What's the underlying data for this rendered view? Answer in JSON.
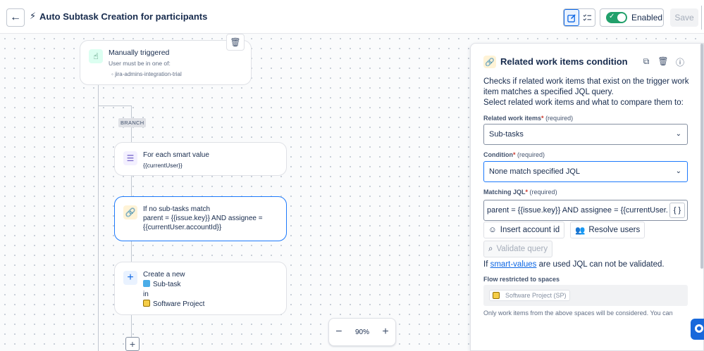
{
  "header": {
    "back_icon": "arrow-left-icon",
    "rule_icon": "lightning-icon",
    "title": "Auto Subtask Creation for participants",
    "enabled_label": "Enabled",
    "save_label": "Save"
  },
  "canvas": {
    "trigger": {
      "title": "Manually triggered",
      "subtitle": "User must be in one of:",
      "group": "jira-admins-integration-trial"
    },
    "branch_label": "BRANCH",
    "foreach": {
      "title": "For each smart value",
      "value": "{{currentUser}}"
    },
    "condition": {
      "title": "If no sub-tasks match",
      "line1": "parent = {{issue.key}} AND assignee =",
      "line2": "{{currentUser.accountId}}"
    },
    "create": {
      "title": "Create a new",
      "type": "Sub-task",
      "in": "in",
      "project": "Software Project"
    },
    "zoom_level": "90%"
  },
  "panel": {
    "title": "Related work items condition",
    "description": "Checks if related work items that exist on the trigger work item matches a specified JQL query.",
    "description2": "Select related work items and what to compare them to:",
    "related_label": "Related work items",
    "required_text": "(required)",
    "related_value": "Sub-tasks",
    "condition_label": "Condition",
    "condition_value": "None match specified JQL",
    "jql_label": "Matching JQL",
    "jql_value": "parent = {{issue.key}} AND assignee = {{currentUser.accountId}}",
    "brace_label": "{ }",
    "insert_account_label": "Insert account id",
    "resolve_users_label": "Resolve users",
    "validate_label": "Validate query",
    "smart_note_prefix": "If",
    "smart_note_link": "smart-values",
    "smart_note_suffix": "are used JQL can not be validated.",
    "flow_label": "Flow restricted to spaces",
    "flow_chip": "Software Project (SP)",
    "foot_note": "Only work items from the above spaces will be considered. You can"
  }
}
